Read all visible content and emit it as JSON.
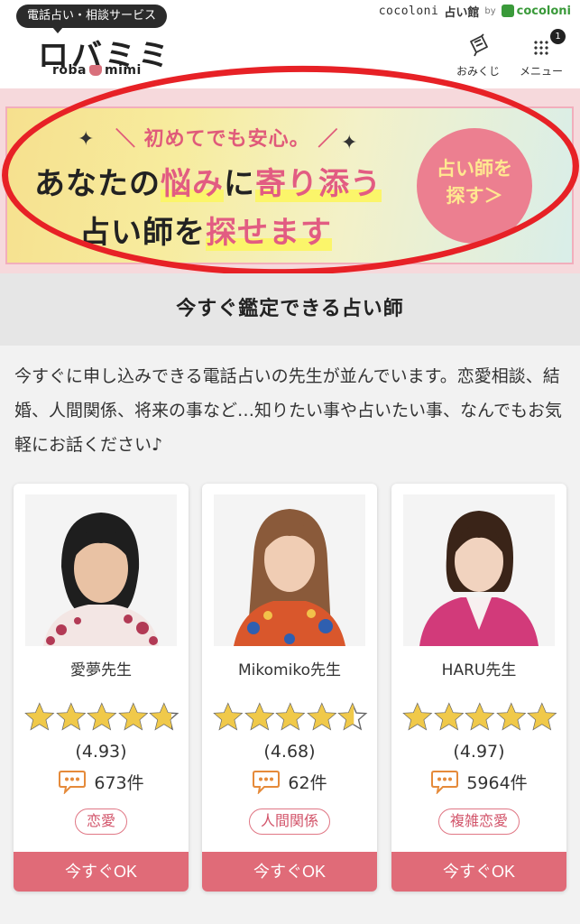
{
  "header": {
    "service_badge": "電話占い・相談サービス",
    "logo_jp": "ロバミミ",
    "logo_en_left": "roba",
    "logo_en_right": "mimi",
    "partner_text": "cocoloni",
    "partner_kan": "占い館",
    "partner_by": "by",
    "partner_brand": "cocoloni",
    "omikuji_label": "おみくじ",
    "menu_label": "メニュー",
    "menu_badge": "1"
  },
  "banner": {
    "sub_copy": "＼ 初めてでも安心。 ／",
    "line1_a": "あなたの",
    "line1_hl1": "悩み",
    "line1_b": "に",
    "line1_hl2": "寄り添う",
    "line2_a": "占い師を",
    "line2_hl": "探せます",
    "cta_line1": "占い師を",
    "cta_line2": "探す＞"
  },
  "section": {
    "title": "今すぐ鑑定できる占い師",
    "intro": "今すぐに申し込みできる電話占いの先生が並んでいます。恋愛相談、結婚、人間関係、将来の事など…知りたい事や占いたい事、なんでもお気軽にお話ください♪"
  },
  "fortune_tellers": [
    {
      "name": "愛夢先生",
      "rating": "(4.93)",
      "rating_value": 4.93,
      "reviews": "673件",
      "tag": "恋愛",
      "button": "今すぐOK"
    },
    {
      "name": "Mikomiko先生",
      "rating": "(4.68)",
      "rating_value": 4.68,
      "reviews": "62件",
      "tag": "人間関係",
      "button": "今すぐOK"
    },
    {
      "name": "HARU先生",
      "rating": "(4.97)",
      "rating_value": 4.97,
      "reviews": "5964件",
      "tag": "複雑恋愛",
      "button": "今すぐOK"
    }
  ],
  "colors": {
    "accent_pink": "#e06b78",
    "highlight_pink": "#e25c82",
    "star_gold": "#f0c94a",
    "annotation_red": "#e72126"
  }
}
